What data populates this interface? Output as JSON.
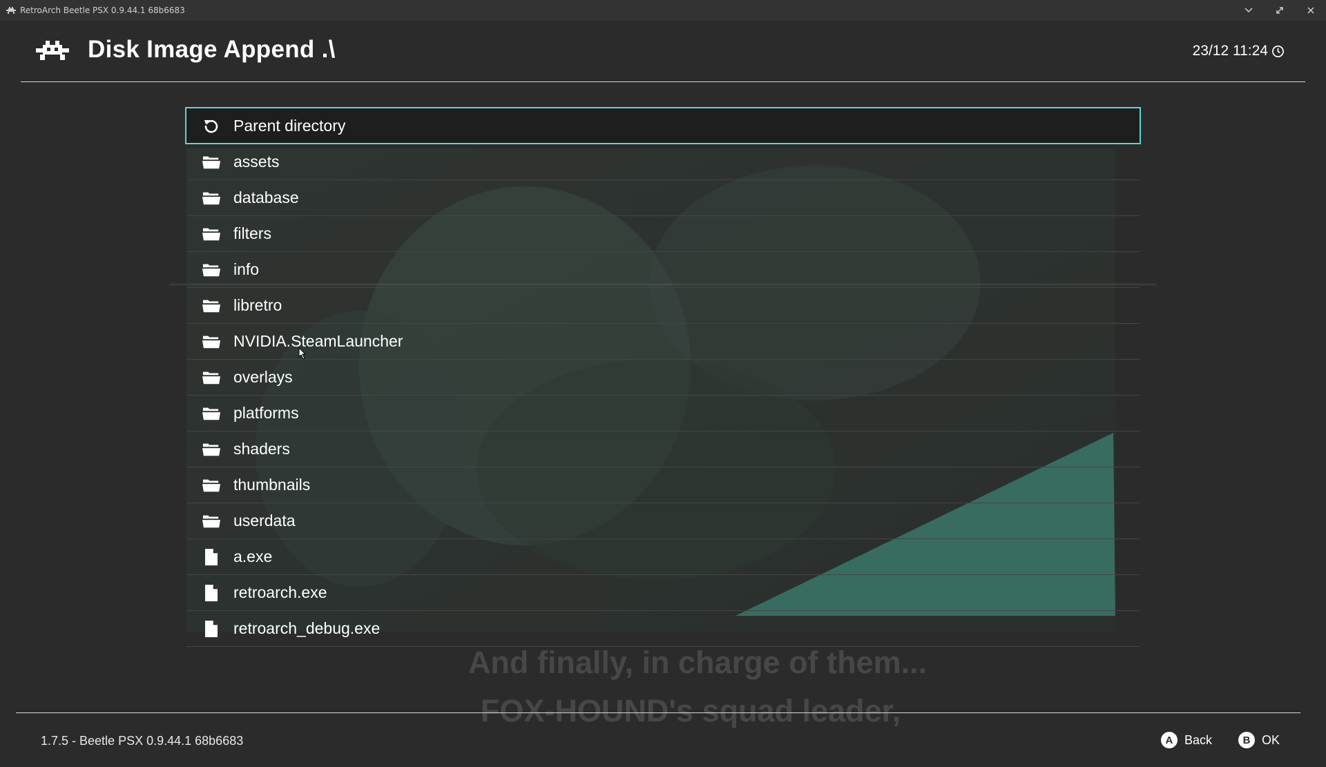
{
  "window": {
    "title": "RetroArch Beetle PSX 0.9.44.1 68b6683",
    "controls": [
      "chevron-down-icon",
      "maximize-icon",
      "close-icon"
    ]
  },
  "header": {
    "title": "Disk Image Append .\\",
    "clock": "23/12 11:24"
  },
  "list": {
    "items": [
      {
        "label": "Parent directory",
        "icon": "refresh-icon",
        "selected": true
      },
      {
        "label": "assets",
        "icon": "folder-icon"
      },
      {
        "label": "database",
        "icon": "folder-icon"
      },
      {
        "label": "filters",
        "icon": "folder-icon"
      },
      {
        "label": "info",
        "icon": "folder-icon"
      },
      {
        "label": "libretro",
        "icon": "folder-icon"
      },
      {
        "label": "NVIDIA.SteamLauncher",
        "icon": "folder-icon"
      },
      {
        "label": "overlays",
        "icon": "folder-icon"
      },
      {
        "label": "platforms",
        "icon": "folder-icon"
      },
      {
        "label": "shaders",
        "icon": "folder-icon"
      },
      {
        "label": "thumbnails",
        "icon": "folder-icon"
      },
      {
        "label": "userdata",
        "icon": "folder-icon"
      },
      {
        "label": "a.exe",
        "icon": "file-icon"
      },
      {
        "label": "retroarch.exe",
        "icon": "file-icon"
      },
      {
        "label": "retroarch_debug.exe",
        "icon": "file-icon"
      }
    ]
  },
  "background": {
    "subtitle_line1": "And finally, in charge of them...",
    "subtitle_line2": "FOX-HOUND's squad leader,"
  },
  "footer": {
    "version": "1.7.5 - Beetle PSX 0.9.44.1 68b6683",
    "hints": [
      {
        "glyph": "A",
        "label": "Back"
      },
      {
        "glyph": "B",
        "label": "OK"
      }
    ]
  },
  "colors": {
    "accent": "#5fd4d0",
    "background": "#2b2b2b",
    "titlebar": "#333333"
  }
}
